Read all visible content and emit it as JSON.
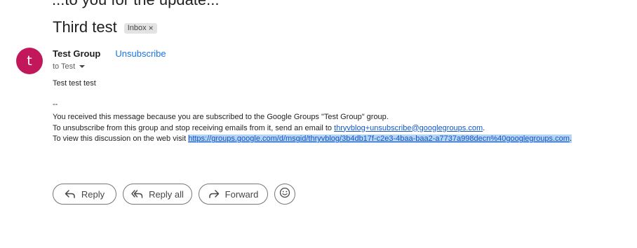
{
  "top_cut_text": "...to you for the update...",
  "subject": "Third test",
  "label": {
    "text": "Inbox",
    "close": "×"
  },
  "sender": {
    "initial": "t",
    "name": "Test Group",
    "unsubscribe": "Unsubscribe",
    "to": "to Test"
  },
  "message": {
    "body": "Test test test",
    "separator": "--",
    "footer_line1": "You received this message because you are subscribed to the Google Groups \"Test Group\" group.",
    "footer_line2_prefix": "To unsubscribe from this group and stop receiving emails from it, send an email to ",
    "footer_line2_link": "thryvblog+unsubscribe@googlegroups.com",
    "footer_line2_suffix": ".",
    "footer_line3_prefix": "To view this discussion on the web visit ",
    "footer_line3_link": "https://groups.google.com/d/msgid/thryvblog/3b4db17f-c2e3-4baa-baa2-a7737a998decn%40googlegroups.com",
    "footer_line3_suffix": "."
  },
  "actions": {
    "reply": "Reply",
    "reply_all": "Reply all",
    "forward": "Forward"
  },
  "colors": {
    "avatar": "#c2185b",
    "link": "#1a73e8",
    "selection": "#b6d5f2"
  }
}
